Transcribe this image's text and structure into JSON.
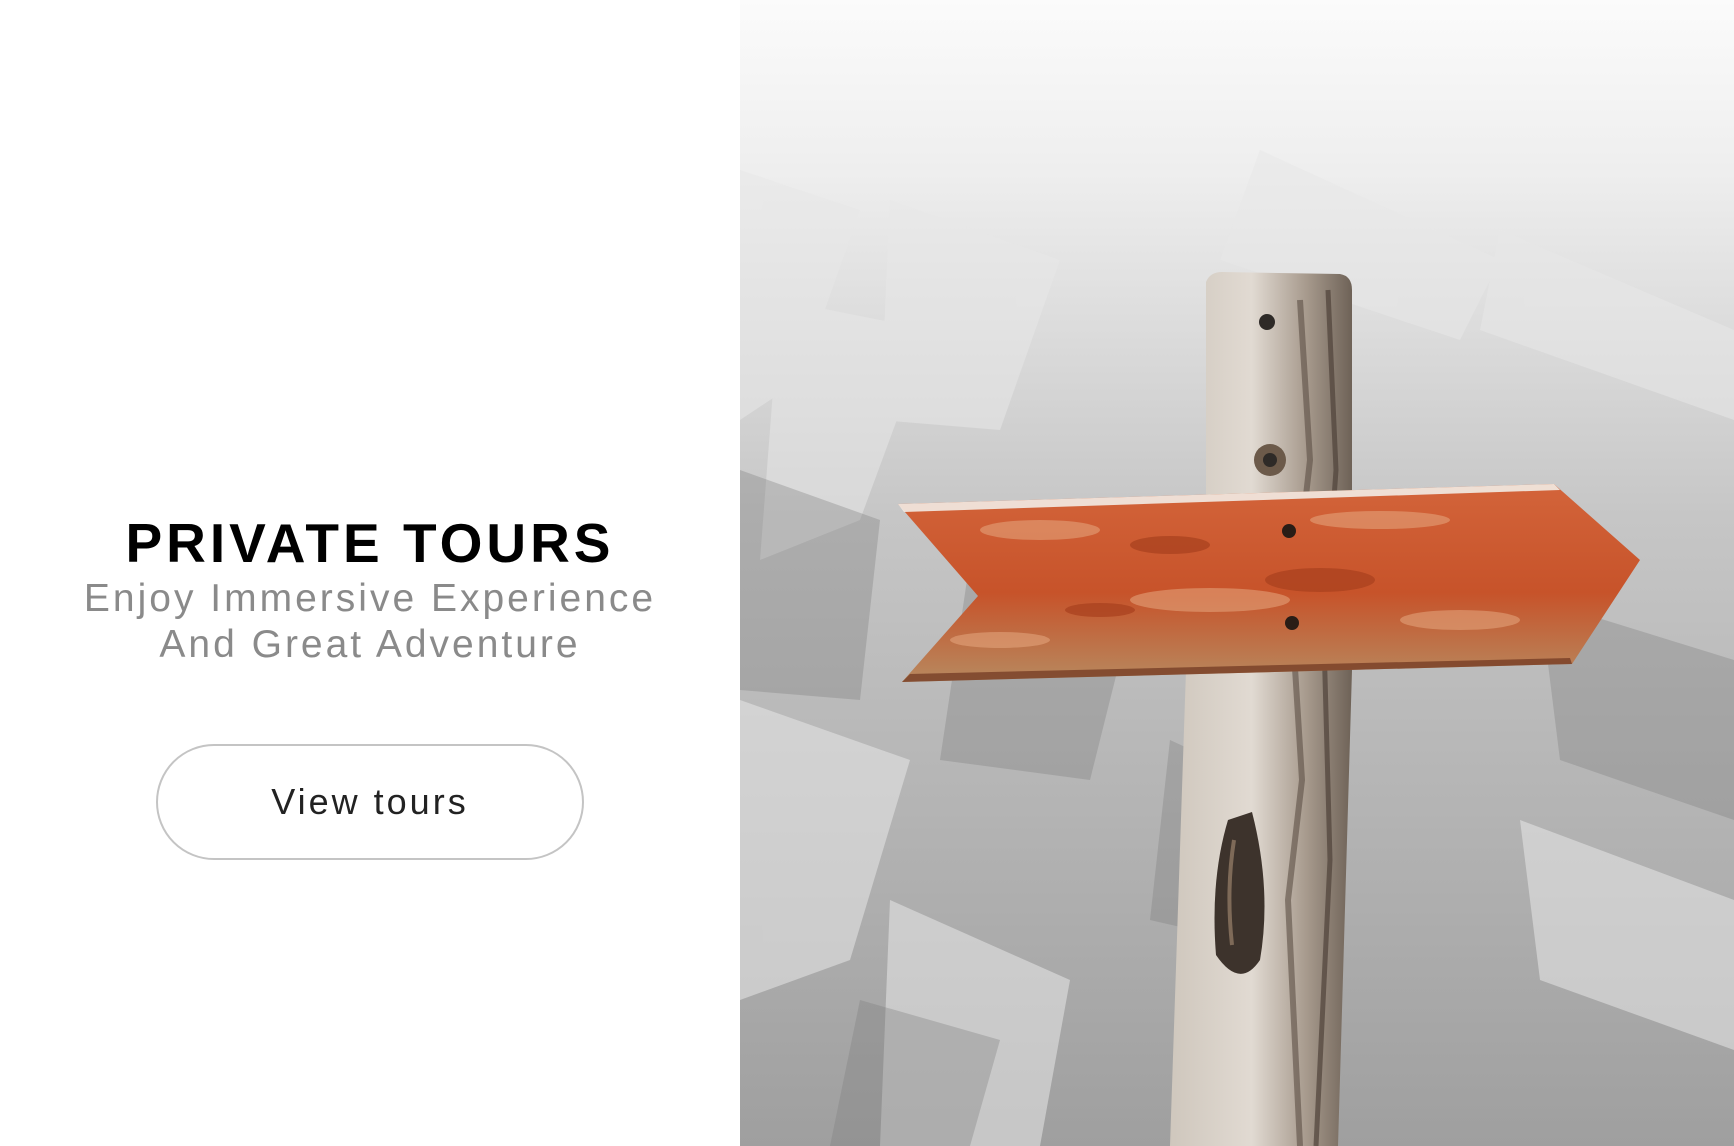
{
  "hero": {
    "title": "PRIVATE TOURS",
    "subtitle_line1": "Enjoy Immersive Experience",
    "subtitle_line2": "And Great Adventure",
    "button_label": "View tours"
  },
  "photo": {
    "subject": "wooden-arrow-signpost-icon"
  },
  "colors": {
    "title": "#000000",
    "subtitle": "#8a8a8a",
    "button_border": "#c4c4c4",
    "sign": "#c9562c",
    "post": "#b9afa5"
  }
}
